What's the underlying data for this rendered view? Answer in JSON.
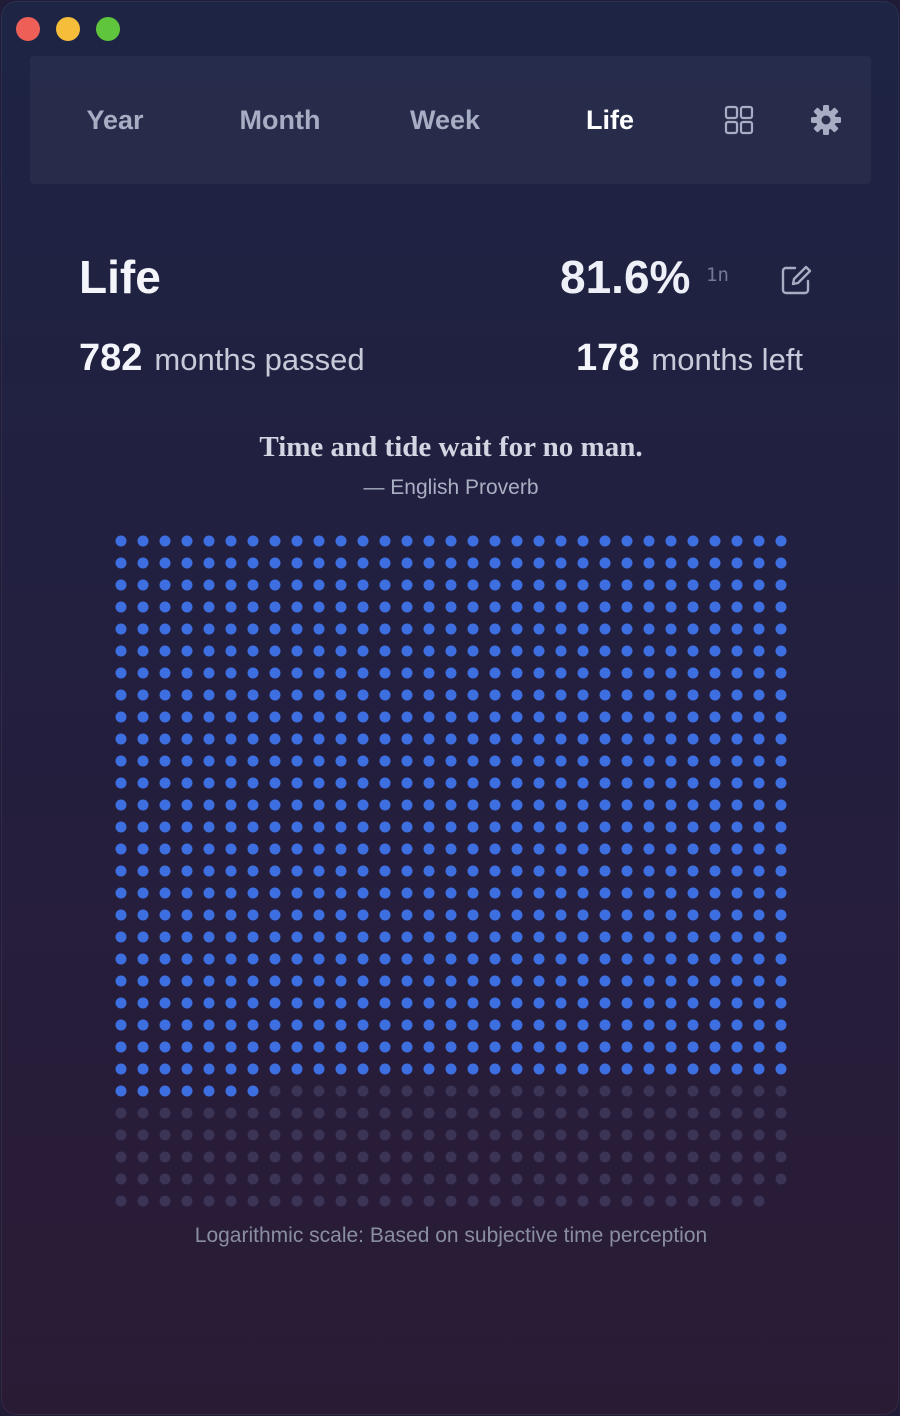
{
  "window": {
    "controls": [
      "close",
      "minimize",
      "zoom"
    ]
  },
  "nav": {
    "tabs": [
      {
        "label": "Year",
        "active": false
      },
      {
        "label": "Month",
        "active": false
      },
      {
        "label": "Week",
        "active": false
      },
      {
        "label": "Life",
        "active": true
      }
    ],
    "icons": [
      "grid-icon",
      "gear-icon"
    ]
  },
  "header": {
    "title": "Life",
    "percent": "81.6%",
    "precision_tag": "1n",
    "edit_icon": "edit-icon"
  },
  "stats": {
    "passed_value": "782",
    "passed_label": "months passed",
    "left_value": "178",
    "left_label": "months left"
  },
  "quote": {
    "text": "Time and tide wait for no man.",
    "author": "— English Proverb"
  },
  "grid": {
    "total": 960,
    "filled": 782,
    "columns": 31,
    "filled_color": "#3d6fe0",
    "empty_color": "#3b3454"
  },
  "caption": "Logarithmic scale: Based on subjective time perception",
  "colors": {
    "accent": "#3d6fe0",
    "active_tab": "#ffffff",
    "inactive_tab": "#a7aec3"
  }
}
